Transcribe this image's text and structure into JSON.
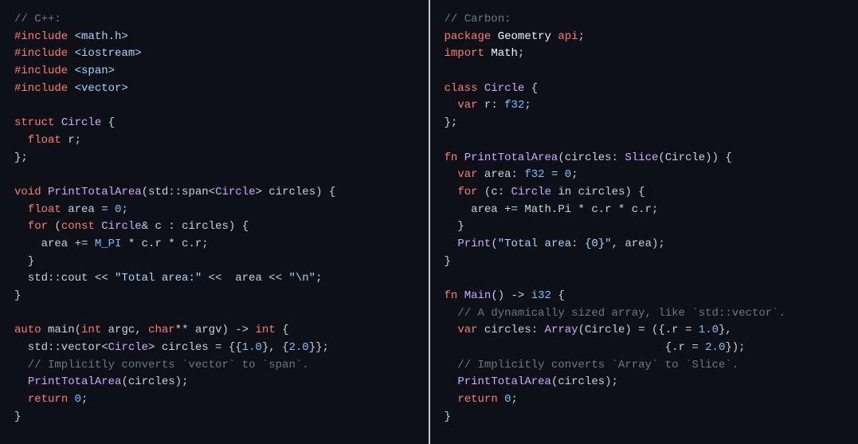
{
  "left": {
    "comment": "// C++:",
    "includes": [
      {
        "dir": "#include",
        "hdr": "<math.h>"
      },
      {
        "dir": "#include",
        "hdr": "<iostream>"
      },
      {
        "dir": "#include",
        "hdr": "<span>"
      },
      {
        "dir": "#include",
        "hdr": "<vector>"
      }
    ],
    "struct_kw": "struct",
    "struct_name": "Circle",
    "struct_open": " {",
    "struct_field_type": "float",
    "struct_field_name": " r;",
    "struct_close": "};",
    "void_kw": "void",
    "pta_name": "PrintTotalArea",
    "pta_sig_1": "(std::span<",
    "pta_sig_ty": "Circle",
    "pta_sig_2": "> circles) {",
    "area_type": "float",
    "area_rest": " area = ",
    "area_zero": "0",
    "area_semi": ";",
    "for_kw": "for",
    "for_open": " (",
    "const_kw": "const",
    "for_ty": "Circle",
    "for_amp": "& c : circles) {",
    "pi_const": "M_PI",
    "area_expr_pre": "    area += ",
    "area_expr_post": " * c.r * c.r;",
    "cout_pre": "  std::cout << ",
    "cout_str1": "\"Total area:\"",
    "cout_mid": " <<  area << ",
    "cout_str2": "\"\\n\"",
    "cout_end": ";",
    "auto_kw": "auto",
    "main_name": " main(",
    "int_kw": "int",
    "argc": " argc, ",
    "char_kw": "char",
    "argv": "** argv) -> ",
    "int_ret": "int",
    "main_open": " {",
    "vec_pre": "  std::vector<",
    "vec_ty": "Circle",
    "vec_post": "> circles = {{",
    "num1": "1.0",
    "vec_mid": "}, {",
    "num2": "2.0",
    "vec_end": "}};",
    "impl_comment": "  // Implicitly converts `vector` to `span`.",
    "pta_call": "PrintTotalArea",
    "pta_call_args": "(circles);",
    "return_kw": "return",
    "ret_zero": "0",
    "ret_semi": ";",
    "close": "}"
  },
  "right": {
    "comment": "// Carbon:",
    "pkg_kw": "package",
    "pkg_name": "Geometry",
    "api_kw": "api",
    "pkg_semi": ";",
    "import_kw": "import",
    "import_name": "Math",
    "import_semi": ";",
    "class_kw": "class",
    "class_name": "Circle",
    "class_open": " {",
    "var_kw": "var",
    "var_r": " r: ",
    "f32": "f32",
    "var_semi": ";",
    "class_close": "};",
    "fn_kw": "fn",
    "pta_name": "PrintTotalArea",
    "pta_open": "(circles: ",
    "slice_fn": "Slice",
    "slice_arg": "(Circle)) {",
    "area_var": "var",
    "area_name": " area: ",
    "area_ty": "f32",
    "area_eq": " = ",
    "area_zero": "0",
    "area_semi": ";",
    "for_kw": "for",
    "for_open": " (c: ",
    "for_ty": "Circle",
    "for_in": " in circles) {",
    "area_expr": "    area += Math.Pi * c.r * c.r;",
    "print_fn": "Print",
    "print_open": "(",
    "print_str": "\"Total area: {0}\"",
    "print_rest": ", area);",
    "main_name": "Main",
    "main_sig": "() -> ",
    "i32": "i32",
    "main_open": " {",
    "dyn_comment": "  // A dynamically sized array, like `std::vector`.",
    "circ_var": "var",
    "circ_name": " circles: ",
    "array_fn": "Array",
    "array_arg": "(Circle) = ({.r = ",
    "num1": "1.0",
    "arr_mid": "},",
    "arr_line2_pre": "                                 {.r = ",
    "num2": "2.0",
    "arr_line2_end": "});",
    "impl_comment": "  // Implicitly converts `Array` to `Slice`.",
    "pta_call": "PrintTotalArea",
    "pta_call_args": "(circles);",
    "return_kw": "return",
    "ret_zero": "0",
    "ret_semi": ";",
    "close": "}"
  }
}
